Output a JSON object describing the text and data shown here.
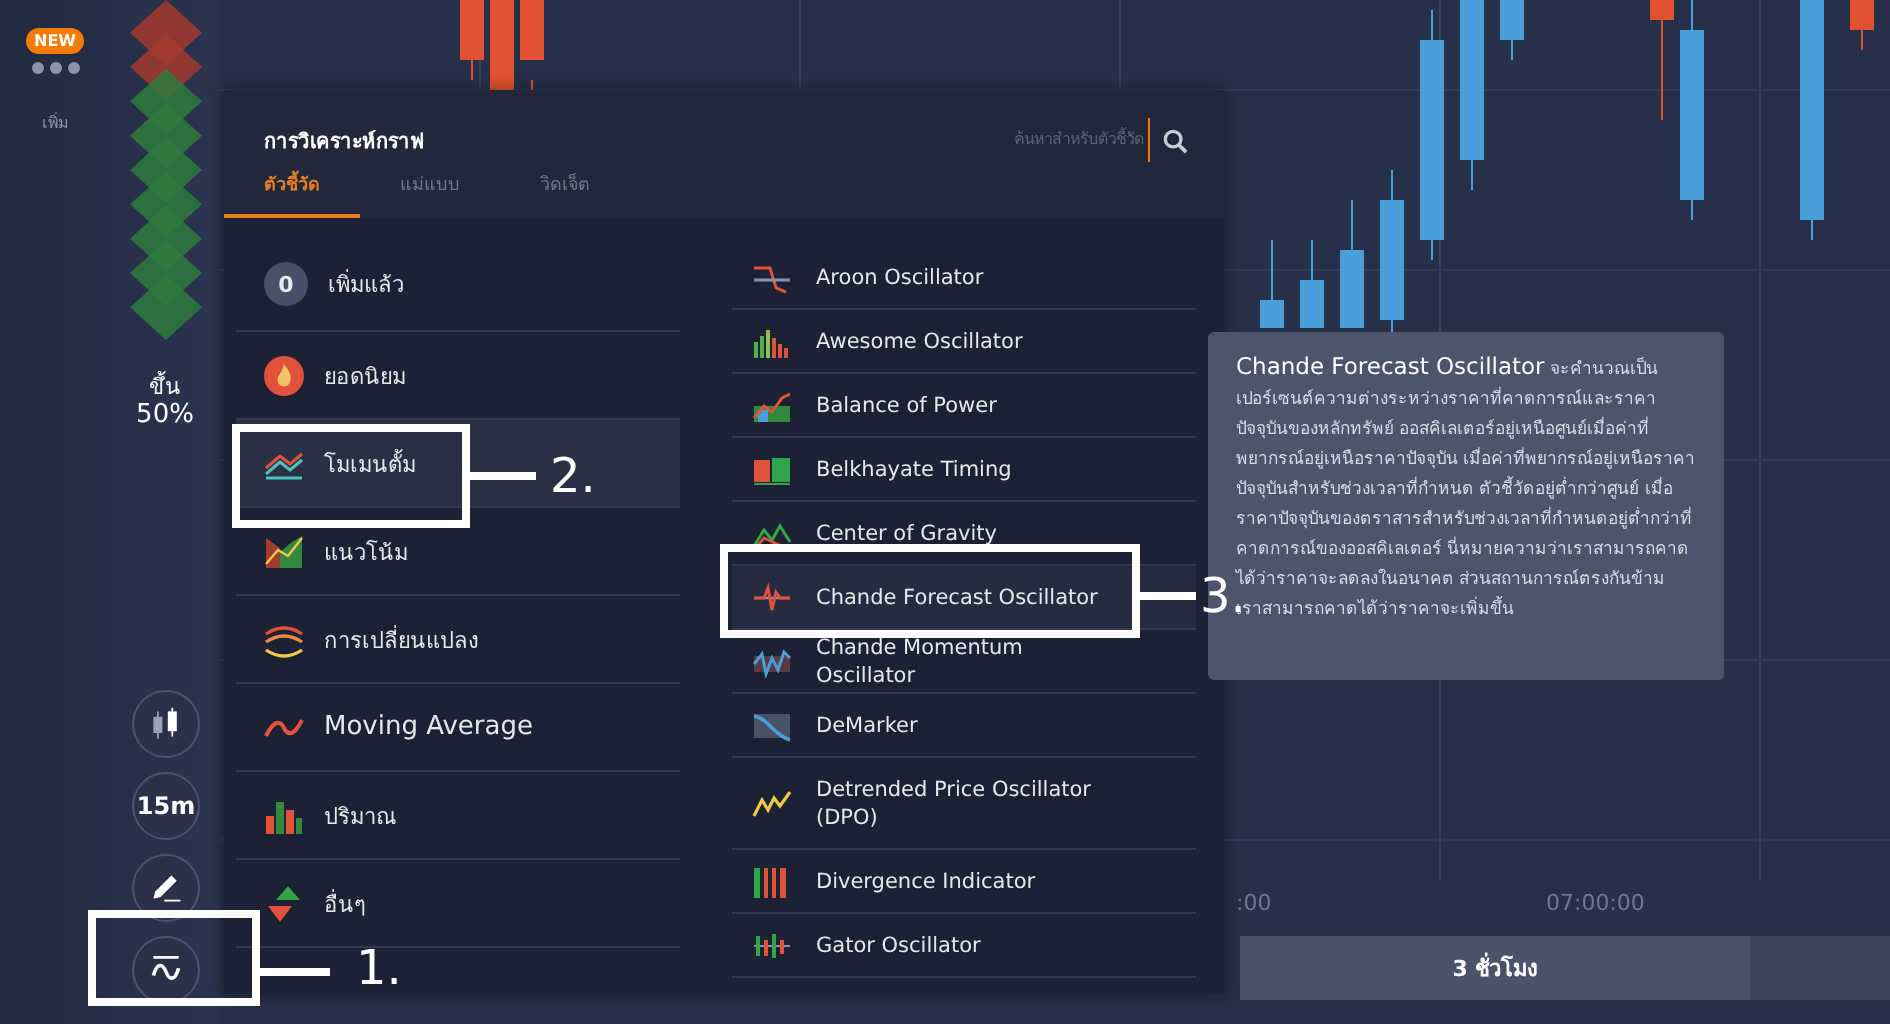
{
  "sidebar": {
    "badge": "NEW",
    "more_label": "เพิ่ม",
    "sentiment": {
      "label": "ขึ้น",
      "value": "50%"
    },
    "tools": [
      {
        "kind": "chart-type"
      },
      {
        "kind": "timeframe",
        "label": "15m"
      },
      {
        "kind": "draw"
      },
      {
        "kind": "indicators"
      }
    ]
  },
  "chart": {
    "time_labels": [
      ":00",
      "07:00:00"
    ]
  },
  "timeline": {
    "button": "3 ชั่วโมง"
  },
  "panel": {
    "title": "การวิเคราะห์กราฟ",
    "search": {
      "placeholder": "ค้นหาสำหรับตัวชี้วัด"
    },
    "tabs": [
      {
        "label": "ตัวชี้วัด",
        "selected": true
      },
      {
        "label": "แม่แบบ",
        "selected": false
      },
      {
        "label": "วิดเจ็ต",
        "selected": false
      }
    ],
    "categories": [
      {
        "kind": "added",
        "count": "0",
        "label": "เพิ่มแล้ว",
        "selected": false
      },
      {
        "kind": "popular",
        "label": "ยอดนิยม",
        "selected": false
      },
      {
        "kind": "momentum",
        "label": "โมเมนตั้ม",
        "selected": true
      },
      {
        "kind": "trend",
        "label": "แนวโน้ม",
        "selected": false
      },
      {
        "kind": "volatility",
        "label": "การเปลี่ยนแปลง",
        "selected": false
      },
      {
        "kind": "moving-average",
        "label": "Moving Average",
        "selected": false
      },
      {
        "kind": "volume",
        "label": "ปริมาณ",
        "selected": false
      },
      {
        "kind": "other",
        "label": "อื่นๆ",
        "selected": false
      }
    ],
    "indicators": [
      {
        "kind": "aroon",
        "label": "Aroon Oscillator",
        "selected": false
      },
      {
        "kind": "bars",
        "label": "Awesome Oscillator",
        "selected": false
      },
      {
        "kind": "power",
        "label": "Balance of Power",
        "selected": false
      },
      {
        "kind": "blocks",
        "label": "Belkhayate Timing",
        "selected": false
      },
      {
        "kind": "zigzag",
        "label": "Center of Gravity",
        "selected": false
      },
      {
        "kind": "pulse",
        "label": "Chande Forecast Oscillator",
        "selected": true
      },
      {
        "kind": "wave",
        "label": "Chande Momentum Oscillator",
        "selected": false
      },
      {
        "kind": "slope",
        "label": "DeMarker",
        "selected": false
      },
      {
        "kind": "yellow",
        "label": "Detrended Price Oscillator (DPO)",
        "selected": false
      },
      {
        "kind": "stripes",
        "label": "Divergence Indicator",
        "selected": false
      },
      {
        "kind": "gator",
        "label": "Gator Oscillator",
        "selected": false
      }
    ]
  },
  "tooltip": {
    "title": "Chande Forecast Oscillator",
    "text": "จะคำนวณเป็นเปอร์เซนต์ความต่างระหว่างราคาที่คาดการณ์และราคาปัจจุบันของหลักทรัพย์  ออสคิเลเตอร์อยู่เหนือศูนย์เมื่อค่าที่พยากรณ์อยู่เหนือราคาปัจจุบัน เมื่อค่าที่พยากรณ์อยู่เหนือราคาปัจจุบันสำหรับช่วงเวลาที่กำหนด ตัวชี้วัดอยู่ต่ำกว่าศูนย์ เมื่อราคาปัจจุบันของตราสารสำหรับช่วงเวลาที่กำหนดอยู่ต่ำกว่าที่คาดการณ์ของออสคิเลเตอร์ นี่หมายความว่าเราสามารถคาดได้ว่าราคาจะลดลงในอนาคต ส่วนสถานการณ์ตรงกันข้าม เราสามารถคาดได้ว่าราคาจะเพิ่มขึ้น"
  },
  "annotations": [
    {
      "label": "1."
    },
    {
      "label": "2."
    },
    {
      "label": "3."
    }
  ]
}
